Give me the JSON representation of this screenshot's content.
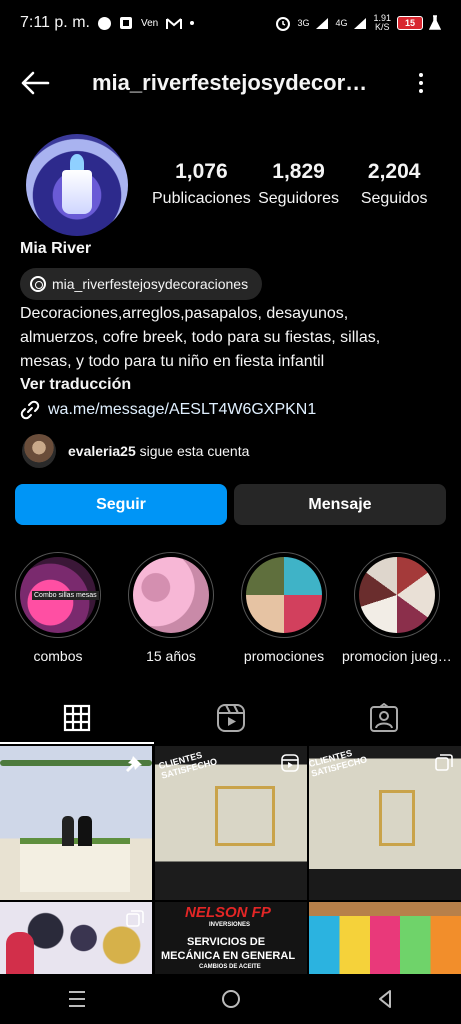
{
  "status_bar": {
    "time": "7:11 p. m.",
    "net1": "3G",
    "net2": "4G",
    "speed": "1.91",
    "speed_unit": "K/S",
    "battery": "15"
  },
  "header": {
    "username": "mia_riverfestejosydecoraciones",
    "back_icon": "arrow-left-icon",
    "more_icon": "more-vertical-icon"
  },
  "profile": {
    "stats": [
      {
        "value": "1,076",
        "label": "Publicaciones"
      },
      {
        "value": "1,829",
        "label": "Seguidores"
      },
      {
        "value": "2,204",
        "label": "Seguidos"
      }
    ],
    "display_name": "Mia River",
    "threads_handle": "mia_riverfestejosydecoraciones",
    "bio_lines": [
      "Decoraciones,arreglos,pasapalos, desayunos,",
      "almuerzos, cofre breek, todo para su fiestas, sillas,",
      "mesas, y todo para tu niño en fiesta infantil"
    ],
    "translate": "Ver traducción",
    "link": "wa.me/message/AESLT4W6GXPKN1",
    "followed_by_user": "evaleria25",
    "followed_by_text": "sigue esta cuenta"
  },
  "actions": {
    "follow": "Seguir",
    "message": "Mensaje"
  },
  "highlights": [
    {
      "label": "combos",
      "caption": "Combo sillas mesas",
      "colors": [
        "#ff4fa3",
        "#7a2a6e"
      ]
    },
    {
      "label": "15 años",
      "caption": "",
      "colors": [
        "#f7b7d6",
        "#c98aa8"
      ]
    },
    {
      "label": "promociones",
      "caption": "",
      "colors": [
        "#3fb3c7",
        "#d2405d"
      ]
    },
    {
      "label": "promocion juegos",
      "caption": "",
      "colors": [
        "#a43a3a",
        "#e9e0d6"
      ]
    }
  ],
  "tabs": [
    {
      "name": "grid-icon",
      "active": true
    },
    {
      "name": "reels-icon",
      "active": false
    },
    {
      "name": "tagged-icon",
      "active": false
    }
  ],
  "grid": {
    "tile2_text": "CLIENTES SATISFECHO",
    "tile3_text": "CLIENTES SATISFECHO",
    "tile5_title": "NELSON FP",
    "tile5_sub": "INVERSIONES",
    "tile5_line1": "SERVICIOS DE",
    "tile5_line2": "MECÁNICA EN GENERAL",
    "tile5_line3": "CAMBIOS DE ACEITE"
  }
}
